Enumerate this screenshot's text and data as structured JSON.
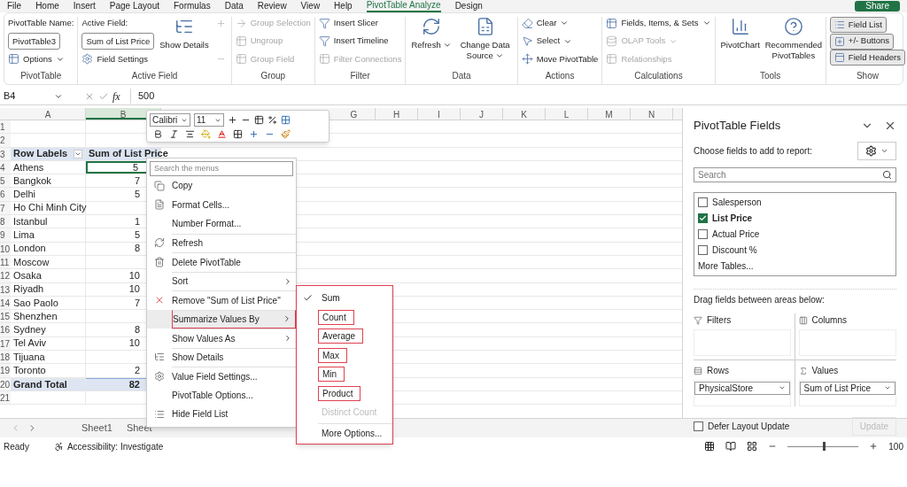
{
  "ribbon_tabs": [
    {
      "label": "File",
      "selected": false
    },
    {
      "label": "Home",
      "selected": false
    },
    {
      "label": "Insert",
      "selected": false
    },
    {
      "label": "Page Layout",
      "selected": false
    },
    {
      "label": "Formulas",
      "selected": false
    },
    {
      "label": "Data",
      "selected": false
    },
    {
      "label": "Review",
      "selected": false
    },
    {
      "label": "View",
      "selected": false
    },
    {
      "label": "Help",
      "selected": false
    },
    {
      "label": "PivotTable Analyze",
      "selected": true
    },
    {
      "label": "Design",
      "selected": false
    }
  ],
  "share_button": "Share",
  "ribbon_groups": [
    {
      "label": "PivotTable",
      "columns": [
        [
          {
            "kind": "caption",
            "label": "PivotTable Name:"
          },
          {
            "kind": "field",
            "value": "PivotTable3"
          },
          {
            "kind": "small",
            "label": "Options",
            "caret": true,
            "disabled": false
          }
        ]
      ]
    },
    {
      "label": "Active Field",
      "columns": [
        [
          {
            "kind": "caption",
            "label": "Active Field:"
          },
          {
            "kind": "field",
            "value": "Sum of List Price"
          },
          {
            "kind": "small",
            "label": "Field Settings",
            "caret": false,
            "disabled": false
          }
        ],
        [
          {
            "kind": "large",
            "label": "Show Details",
            "caret": false,
            "disabled": false
          }
        ],
        [
          {
            "kind": "icon",
            "disabled": true
          },
          {
            "kind": "icon",
            "disabled": true
          }
        ]
      ]
    },
    {
      "label": "Group",
      "columns": [
        [
          {
            "kind": "small",
            "label": "Group Selection",
            "caret": false,
            "disabled": true
          },
          {
            "kind": "small",
            "label": "Ungroup",
            "caret": false,
            "disabled": true
          },
          {
            "kind": "small",
            "label": "Group Field",
            "caret": false,
            "disabled": true
          }
        ]
      ]
    },
    {
      "label": "Filter",
      "columns": [
        [
          {
            "kind": "small",
            "label": "Insert Slicer",
            "caret": false,
            "disabled": false
          },
          {
            "kind": "small",
            "label": "Insert Timeline",
            "caret": false,
            "disabled": false
          },
          {
            "kind": "small",
            "label": "Filter Connections",
            "caret": false,
            "disabled": true
          }
        ]
      ]
    },
    {
      "label": "Data",
      "columns": [
        [
          {
            "kind": "large",
            "label": "Refresh",
            "caret": true,
            "disabled": false
          }
        ],
        [
          {
            "kind": "large",
            "label": "Change Data Source",
            "caret": true,
            "disabled": false
          }
        ]
      ]
    },
    {
      "label": "Actions",
      "columns": [
        [
          {
            "kind": "small",
            "label": "Clear",
            "caret": true,
            "disabled": false
          },
          {
            "kind": "small",
            "label": "Select",
            "caret": true,
            "disabled": false
          },
          {
            "kind": "small",
            "label": "Move PivotTable",
            "caret": false,
            "disabled": false
          }
        ]
      ]
    },
    {
      "label": "Calculations",
      "columns": [
        [
          {
            "kind": "small",
            "label": "Fields, Items, & Sets",
            "caret": true,
            "disabled": false
          },
          {
            "kind": "small",
            "label": "OLAP Tools",
            "caret": true,
            "disabled": true
          },
          {
            "kind": "small",
            "label": "Relationships",
            "caret": false,
            "disabled": true
          }
        ]
      ]
    },
    {
      "label": "Tools",
      "columns": [
        [
          {
            "kind": "large",
            "label": "PivotChart",
            "caret": false,
            "disabled": false
          }
        ],
        [
          {
            "kind": "large",
            "label": "Recommended PivotTables",
            "caret": false,
            "disabled": false
          }
        ]
      ]
    },
    {
      "label": "Show",
      "columns": [
        [
          {
            "kind": "toggle",
            "label": "Field List",
            "selected": true
          },
          {
            "kind": "toggle",
            "label": "+/- Buttons",
            "selected": true
          },
          {
            "kind": "toggle",
            "label": "Field Headers",
            "selected": true
          }
        ]
      ]
    }
  ],
  "name_box": "B4",
  "function_label": "fx",
  "formula": "500",
  "columns_left": [
    "A",
    "B"
  ],
  "columns_right": [
    "G",
    "H",
    "I",
    "J",
    "K",
    "L",
    "M",
    "N"
  ],
  "rows": [
    {
      "number": "1",
      "kind": "blank"
    },
    {
      "number": "2",
      "kind": "blank"
    },
    {
      "number": "3",
      "kind": "header",
      "label": "Row Labels",
      "value": "Sum of List Price"
    },
    {
      "number": "4",
      "kind": "item",
      "label": "Athens",
      "value": "5",
      "selected": true
    },
    {
      "number": "5",
      "kind": "item",
      "label": "Bangkok",
      "value": "7",
      "selected": false
    },
    {
      "number": "6",
      "kind": "item",
      "label": "Delhi",
      "value": "5",
      "selected": false
    },
    {
      "number": "7",
      "kind": "item",
      "label": "Ho Chi Minh City",
      "selected": false
    },
    {
      "number": "8",
      "kind": "item",
      "label": "Istanbul",
      "value": "1",
      "selected": false
    },
    {
      "number": "9",
      "kind": "item",
      "label": "Lima",
      "value": "5",
      "selected": false
    },
    {
      "number": "10",
      "kind": "item",
      "label": "London",
      "value": "8",
      "selected": false
    },
    {
      "number": "11",
      "kind": "item",
      "label": "Moscow",
      "selected": false
    },
    {
      "number": "12",
      "kind": "item",
      "label": "Osaka",
      "value": "10",
      "selected": false
    },
    {
      "number": "13",
      "kind": "item",
      "label": "Riyadh",
      "value": "10",
      "selected": false
    },
    {
      "number": "14",
      "kind": "item",
      "label": "Sao Paolo",
      "value": "7",
      "selected": false
    },
    {
      "number": "15",
      "kind": "item",
      "label": "Shenzhen",
      "selected": false
    },
    {
      "number": "16",
      "kind": "item",
      "label": "Sydney",
      "value": "8",
      "selected": false
    },
    {
      "number": "17",
      "kind": "item",
      "label": "Tel Aviv",
      "value": "10",
      "selected": false
    },
    {
      "number": "18",
      "kind": "item",
      "label": "Tijuana",
      "selected": false
    },
    {
      "number": "19",
      "kind": "item",
      "label": "Toronto",
      "value": "2",
      "selected": false
    },
    {
      "number": "20",
      "kind": "total",
      "label": "Grand Total",
      "value": "82"
    },
    {
      "number": "21",
      "kind": "blank"
    }
  ],
  "mini_toolbar": {
    "font": "Calibri",
    "size": "11"
  },
  "context_menu": {
    "search_placeholder": "Search the menus",
    "items": [
      {
        "label": "Copy",
        "submenu": false,
        "divider": false,
        "selected": false,
        "outlined": false
      },
      {
        "label": "Format Cells...",
        "submenu": false,
        "divider": false,
        "selected": false,
        "outlined": false
      },
      {
        "label": "Number Format...",
        "submenu": false,
        "divider": false,
        "selected": false,
        "outlined": false
      },
      {
        "label": "Refresh",
        "submenu": false,
        "divider": true,
        "selected": false,
        "outlined": false
      },
      {
        "label": "Delete PivotTable",
        "submenu": false,
        "divider": true,
        "selected": false,
        "outlined": false
      },
      {
        "label": "Sort",
        "submenu": true,
        "divider": true,
        "selected": false,
        "outlined": false
      },
      {
        "label": "Remove \"Sum of List Price\"",
        "submenu": false,
        "divider": true,
        "selected": false,
        "outlined": false
      },
      {
        "label": "Summarize Values By",
        "submenu": true,
        "divider": true,
        "selected": true,
        "outlined": true
      },
      {
        "label": "Show Values As",
        "submenu": true,
        "divider": true,
        "selected": false,
        "outlined": false
      },
      {
        "label": "Show Details",
        "submenu": false,
        "divider": true,
        "selected": false,
        "outlined": false
      },
      {
        "label": "Value Field Settings...",
        "submenu": false,
        "divider": true,
        "selected": false,
        "outlined": false
      },
      {
        "label": "PivotTable Options...",
        "submenu": false,
        "divider": false,
        "selected": false,
        "outlined": false
      },
      {
        "label": "Hide Field List",
        "submenu": false,
        "divider": false,
        "selected": false,
        "outlined": false
      }
    ]
  },
  "submenu": {
    "outlined": true,
    "items": [
      {
        "label": "Sum",
        "checked": true,
        "outlined": false,
        "disabled": false,
        "divider": false
      },
      {
        "label": "Count",
        "checked": false,
        "outlined": true,
        "disabled": false,
        "divider": false
      },
      {
        "label": "Average",
        "checked": false,
        "outlined": true,
        "disabled": false,
        "divider": false
      },
      {
        "label": "Max",
        "checked": false,
        "outlined": true,
        "disabled": false,
        "divider": false
      },
      {
        "label": "Min",
        "checked": false,
        "outlined": true,
        "disabled": false,
        "divider": false
      },
      {
        "label": "Product",
        "checked": false,
        "outlined": true,
        "disabled": false,
        "divider": false
      },
      {
        "label": "Distinct Count",
        "checked": false,
        "outlined": false,
        "disabled": true,
        "divider": false
      },
      {
        "label": "More Options...",
        "checked": false,
        "outlined": false,
        "disabled": false,
        "divider": true
      }
    ]
  },
  "field_pane": {
    "title": "PivotTable Fields",
    "subtitle": "Choose fields to add to report:",
    "search_placeholder": "Search",
    "fields": [
      {
        "label": "Salesperson",
        "checked": false
      },
      {
        "label": "List Price",
        "checked": true
      },
      {
        "label": "Actual Price",
        "checked": false
      },
      {
        "label": "Discount %",
        "checked": false
      }
    ],
    "more_tables": "More Tables...",
    "areas_caption": "Drag fields between areas below:",
    "areas": [
      {
        "kind": "filters",
        "label": "Filters"
      },
      {
        "kind": "columns",
        "label": "Columns"
      },
      {
        "kind": "rows",
        "label": "Rows",
        "items": [
          "PhysicalStore"
        ]
      },
      {
        "kind": "values",
        "label": "Values",
        "items": [
          "Sum of List Price"
        ]
      }
    ],
    "defer": {
      "label": "Defer Layout Update",
      "checked": false
    },
    "update_button": {
      "label": "Update",
      "disabled": true
    }
  },
  "sheet_tabs": [
    {
      "label": "Sheet1",
      "selected": false
    },
    {
      "label": "Sheet",
      "selected": false
    }
  ],
  "status_bar": {
    "ready": "Ready",
    "accessibility": "Accessibility: Investigate",
    "zoom": "100",
    "zoom_slider": {
      "level": 0.5
    }
  }
}
